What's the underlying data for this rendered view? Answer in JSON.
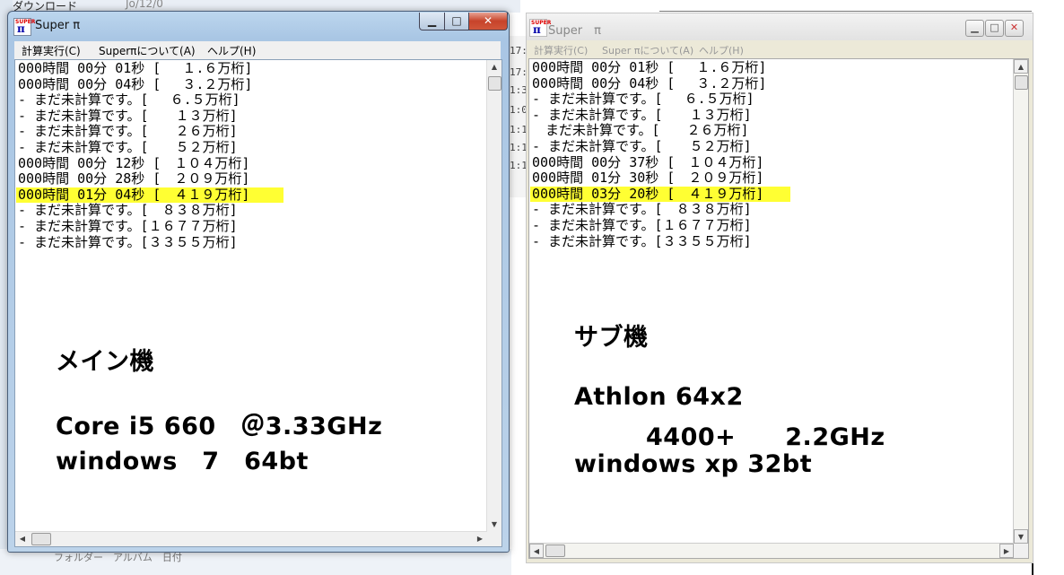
{
  "background": {
    "top_label": "ダウンロード",
    "top_label2": "Jo/12/0",
    "strip_times": [
      "17:",
      "17:",
      "1:3",
      "1:0",
      "1:1",
      "1:1",
      "1:1"
    ],
    "bottom_text": "フォルダー　アルバム　日付"
  },
  "main_window": {
    "title": "Super π",
    "icon_top": "SUPER",
    "icon_pi": "π",
    "buttons": {
      "minimize": "▁",
      "maximize": "□",
      "close": "✕"
    },
    "menu": [
      "計算実行(C)",
      "Superπについて(A)",
      "ヘルプ(H)"
    ],
    "results": [
      "000時間 00分 01秒 [　 １.６万桁]",
      "000時間 00分 04秒 [　 ３.２万桁]",
      "- まだ未計算です。[　 ６.５万桁]",
      "- まだ未計算です。[　　１３万桁]",
      "- まだ未計算です。[　　２６万桁]",
      "- まだ未計算です。[　　５２万桁]",
      "000時間 00分 12秒 [　１０４万桁]",
      "000時間 00分 28秒 [　２０９万桁]",
      "000時間 01分 04秒 [　４１９万桁]",
      "- まだ未計算です。[　８３８万桁]",
      "- まだ未計算です。[１６７７万桁]",
      "- まだ未計算です。[３３５５万桁]"
    ],
    "highlight_index": 8,
    "annotation": {
      "line1": "メイン機",
      "line2": "Core i5 660　＠3.33GHz",
      "line3": "windows　7　64bt"
    }
  },
  "sub_window": {
    "title": "Super　π",
    "icon_top": "SUPER",
    "icon_pi": "π",
    "buttons": {
      "minimize": "▁",
      "maximize": "□",
      "close": "✕"
    },
    "menu": [
      "計算実行(C)",
      "Super πについて(A)",
      "ヘルプ(H)"
    ],
    "results": [
      "000時間 00分 01秒 [　 １.６万桁]",
      "000時間 00分 04秒 [　 ３.２万桁]",
      "- まだ未計算です。[　 ６.５万桁]",
      "- まだ未計算です。[　　１３万桁]",
      "　まだ未計算です。[　　２６万桁]",
      "- まだ未計算です。[　　５２万桁]",
      "000時間 00分 37秒 [　１０４万桁]",
      "000時間 01分 30秒 [　２０９万桁]",
      "000時間 03分 20秒 [　４１９万桁]",
      "- まだ未計算です。[　８３８万桁]",
      "- まだ未計算です。[１６７７万桁]",
      "- まだ未計算です。[３３５５万桁]"
    ],
    "highlight_index": 8,
    "annotation": {
      "line1": "サブ機",
      "line2": "Athlon 64x2",
      "line3": "4400+　　2.2GHz",
      "line4": "windows xp 32bt"
    }
  },
  "colors": {
    "highlight": "#ffff33",
    "close_red": "#c7432a"
  }
}
